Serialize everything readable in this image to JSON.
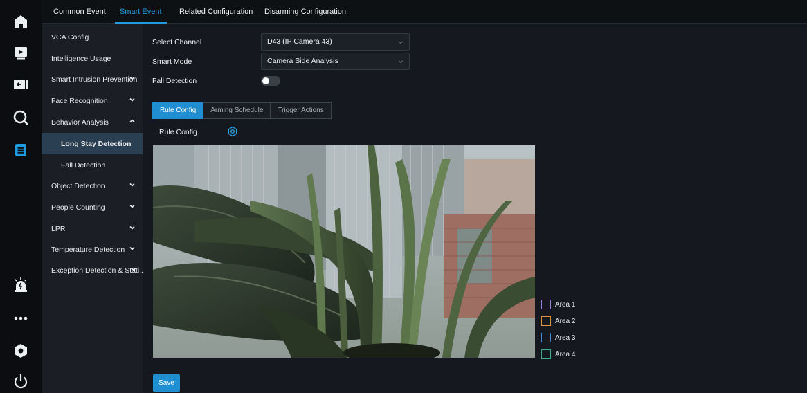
{
  "rail": {
    "items": [
      {
        "icon": "home-icon"
      },
      {
        "icon": "playback-icon"
      },
      {
        "icon": "backup-icon"
      },
      {
        "icon": "search-icon"
      },
      {
        "icon": "event-document-icon",
        "active": true
      },
      {
        "icon": "alarm-icon"
      },
      {
        "icon": "more-icon"
      },
      {
        "icon": "settings-hexagon-icon"
      },
      {
        "icon": "power-icon"
      }
    ]
  },
  "top_tabs": [
    {
      "label": "Common Event"
    },
    {
      "label": "Smart Event",
      "active": true
    },
    {
      "label": "Related Configuration"
    },
    {
      "label": "Disarming Configuration"
    }
  ],
  "side_menu": [
    {
      "label": "VCA Config"
    },
    {
      "label": "Intelligence Usage"
    },
    {
      "label": "Smart Intrusion Prevention",
      "chevron": "down"
    },
    {
      "label": "Face Recognition",
      "chevron": "down"
    },
    {
      "label": "Behavior Analysis",
      "chevron": "up"
    },
    {
      "label": "Long Stay Detection",
      "sub": true,
      "selected": true
    },
    {
      "label": "Fall Detection",
      "sub": true
    },
    {
      "label": "Object Detection",
      "chevron": "down"
    },
    {
      "label": "People Counting",
      "chevron": "down"
    },
    {
      "label": "LPR",
      "chevron": "down"
    },
    {
      "label": "Temperature Detection",
      "chevron": "down"
    },
    {
      "label": "Exception Detection & Stati...",
      "chevron": "down"
    }
  ],
  "form": {
    "channel_label": "Select Channel",
    "channel_value": "D43 (IP Camera 43)",
    "mode_label": "Smart Mode",
    "mode_value": "Camera Side Analysis",
    "fall_label": "Fall Detection",
    "fall_enabled": false
  },
  "sub_tabs": [
    {
      "label": "Rule Config",
      "active": true
    },
    {
      "label": "Arming Schedule"
    },
    {
      "label": "Trigger Actions"
    }
  ],
  "rule": {
    "label": "Rule Config"
  },
  "areas": [
    {
      "label": "Area 1",
      "color": "#9a7fd0"
    },
    {
      "label": "Area 2",
      "color": "#e0903a"
    },
    {
      "label": "Area 3",
      "color": "#3f86d8"
    },
    {
      "label": "Area 4",
      "color": "#3fae8c"
    }
  ],
  "save_label": "Save",
  "colors": {
    "accent": "#1f8fd2",
    "accent_text": "#1f9ce0"
  }
}
